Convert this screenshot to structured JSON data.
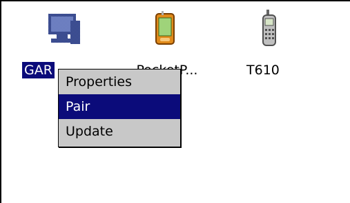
{
  "devices": [
    {
      "name": "GARMIN",
      "label": "GAR",
      "icon": "computer-icon",
      "selected": true
    },
    {
      "name": "Pocket PC",
      "label": "PocketP...",
      "icon": "pda-icon",
      "selected": false
    },
    {
      "name": "T610",
      "label": "T610",
      "icon": "mobile-phone-icon",
      "selected": false
    }
  ],
  "context_menu": {
    "items": [
      {
        "label": "Properties",
        "highlighted": false
      },
      {
        "label": "Pair",
        "highlighted": true
      },
      {
        "label": "Update",
        "highlighted": false
      }
    ]
  },
  "colors": {
    "selection": "#0b0b7a",
    "menu_bg": "#c8c8c8",
    "pane_bg": "#ffffff",
    "frame": "#000000"
  }
}
